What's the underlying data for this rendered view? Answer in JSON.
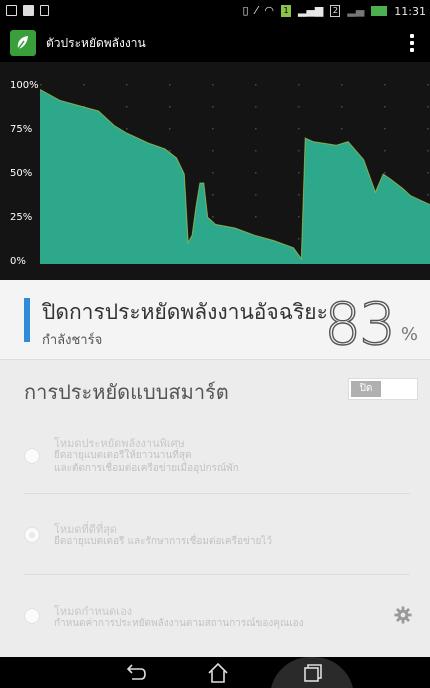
{
  "status_bar": {
    "time": "11:31",
    "icons": [
      "gallery-icon",
      "message-icon",
      "file-icon",
      "vibrate-icon",
      "no-sound-icon",
      "wifi-icon",
      "sim1-icon",
      "signal-icon",
      "sim2-icon",
      "signal-weak-icon",
      "battery-icon"
    ],
    "sim1_label": "1",
    "sim2_label": "2"
  },
  "app_bar": {
    "title": "ตัวประหยัดพลังงาน",
    "logo_icon": "leaf-icon",
    "menu_icon": "overflow-menu-icon"
  },
  "chart_data": {
    "type": "area",
    "ylabels": [
      "100%",
      "75%",
      "50%",
      "25%",
      "0%"
    ],
    "ylim": [
      0,
      100
    ],
    "color": "#2ea88a",
    "series": [
      {
        "values": [
          [
            0,
            97
          ],
          [
            5,
            91
          ],
          [
            10,
            88
          ],
          [
            15,
            85
          ],
          [
            19,
            77
          ],
          [
            22,
            73
          ],
          [
            25,
            70
          ],
          [
            28,
            67
          ],
          [
            32,
            64
          ],
          [
            35,
            59
          ],
          [
            37,
            50
          ],
          [
            38,
            12
          ],
          [
            39,
            16
          ],
          [
            40,
            32
          ],
          [
            41,
            45
          ],
          [
            42,
            45
          ],
          [
            43,
            26
          ],
          [
            44,
            24
          ],
          [
            45,
            22
          ],
          [
            50,
            20
          ],
          [
            55,
            16
          ],
          [
            60,
            13
          ],
          [
            65,
            9
          ],
          [
            67,
            3
          ],
          [
            68,
            70
          ],
          [
            70,
            68
          ],
          [
            73,
            67
          ],
          [
            76,
            66
          ],
          [
            79,
            68
          ],
          [
            83,
            58
          ],
          [
            86,
            40
          ],
          [
            88,
            50
          ],
          [
            90,
            47
          ],
          [
            93,
            42
          ],
          [
            95,
            38
          ],
          [
            97,
            36
          ],
          [
            99,
            34
          ],
          [
            100,
            33
          ]
        ]
      }
    ],
    "grid": true
  },
  "status_card": {
    "title": "ปิดการประหยัดพลังงานอัจฉริยะ",
    "subtitle": "กำลังชาร์จ",
    "battery_percent": "83",
    "percent_sign": "%",
    "accent_color": "#2f8cd8"
  },
  "smart_saving": {
    "title": "การประหยัดแบบสมาร์ต",
    "toggle_label": "ปิด",
    "toggle_state": "off"
  },
  "modes": [
    {
      "title": "โหมดประหยัดพลังงานพิเศษ",
      "desc_line1": "ยืดอายุแบตเตอรีให้ยาวนานที่สุด",
      "desc_line2": "และตัดการเชื่อมต่อเครือข่ายเมื่ออุปกรณ์พัก"
    },
    {
      "title": "โหมดที่ดีที่สุด",
      "desc_line1": "ยืดอายุแบตเตอรี และรักษาการเชื่อมต่อเครือข่ายไว้",
      "desc_line2": ""
    },
    {
      "title": "โหมดกำหนดเอง",
      "desc_line1": "กำหนดค่าการประหยัดพลังงานตามสถานการณ์ของคุณเอง",
      "desc_line2": "",
      "settings_icon": "gear-icon"
    }
  ],
  "nav_bar": {
    "back_icon": "back-icon",
    "home_icon": "home-icon",
    "recents_icon": "recents-icon"
  }
}
